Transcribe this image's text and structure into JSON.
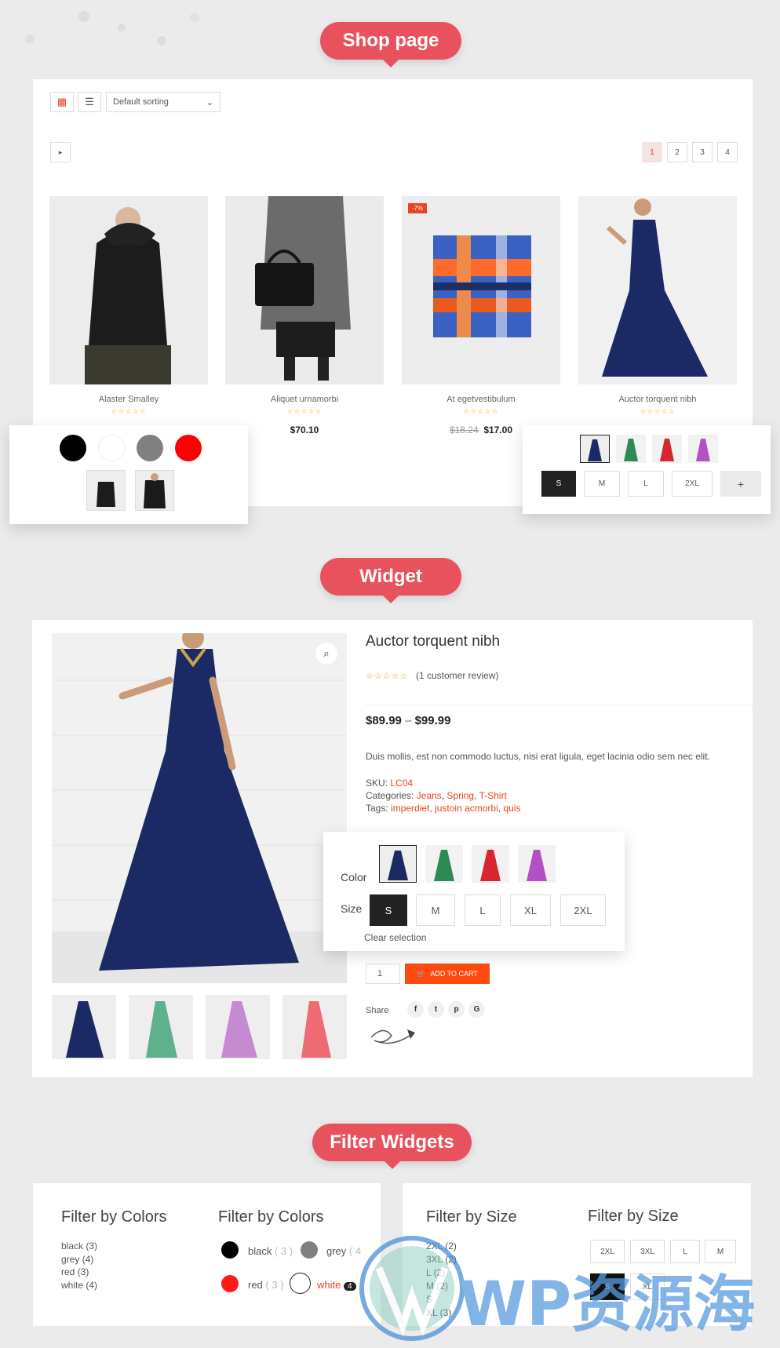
{
  "sections": {
    "shop": "Shop page",
    "widget": "Widget",
    "filters": "Filter Widgets"
  },
  "toolbar": {
    "sort_label": "Default sorting",
    "pages": [
      "1",
      "2",
      "3",
      "4"
    ]
  },
  "products": [
    {
      "name": "Alaster Smalley",
      "stars": "☆☆☆☆☆",
      "price": ""
    },
    {
      "name": "Aliquet urnamorbi",
      "stars": "☆☆☆☆☆",
      "price": "$70.10"
    },
    {
      "name": "At egetvestibulum",
      "stars": "☆☆☆☆☆",
      "price_old": "$18.24",
      "price": "$17.00",
      "badge": "-7%"
    },
    {
      "name": "Auctor torquent nibh",
      "stars": "☆☆☆☆☆",
      "price": ""
    }
  ],
  "swatches": {
    "colors": [
      "#000000",
      "#ffffff",
      "#808080",
      "#ff0000"
    ],
    "sizes": [
      "S",
      "M",
      "L",
      "2XL",
      "+"
    ]
  },
  "detail": {
    "title": "Auctor torquent nibh",
    "stars": "☆☆☆☆☆",
    "review": "(1 customer review)",
    "price_low": "$89.99",
    "price_sep": "–",
    "price_high": "$99.99",
    "description": "Duis mollis, est non commodo luctus, nisi erat ligula, eget lacinia odio sem nec elit.",
    "sku_label": "SKU:",
    "sku": "LC04",
    "categories_label": "Categories:",
    "categories": [
      "Jeans",
      "Spring",
      "T-Shirt"
    ],
    "tags_label": "Tags:",
    "tags": [
      "imperdiet",
      "justoin acmorbi",
      "quis"
    ],
    "color_label": "Color",
    "size_label": "Size",
    "sizes": [
      "S",
      "M",
      "L",
      "XL",
      "2XL"
    ],
    "clear": "Clear selection",
    "qty": "1",
    "add_to_cart": "ADD TO CART",
    "share_label": "Share",
    "share_icons": [
      "f",
      "t",
      "p",
      "G"
    ]
  },
  "filters": {
    "colors_title_a": "Filter by Colors",
    "colors_list": [
      "black (3)",
      "grey (4)",
      "red (3)",
      "white (4)"
    ],
    "colors_title_b": "Filter by Colors",
    "colors_dots": [
      {
        "label": "black",
        "count": "( 3 )",
        "color": "#000000"
      },
      {
        "label": "grey",
        "count": "( 4",
        "color": "#808080"
      },
      {
        "label": "red",
        "count": "( 3 )",
        "color": "#ff1a1a"
      },
      {
        "label": "white",
        "count": "4",
        "color": "#ffffff"
      }
    ],
    "size_title_a": "Filter by Size",
    "size_list": [
      "2XL (2)",
      "3XL (2)",
      "L (2)",
      "M (2)",
      "S",
      "XL (3)"
    ],
    "size_title_b": "Filter by Size",
    "size_boxes": [
      "2XL",
      "3XL",
      "L",
      "M",
      "S",
      "XL"
    ]
  },
  "watermark": "WP资源海"
}
